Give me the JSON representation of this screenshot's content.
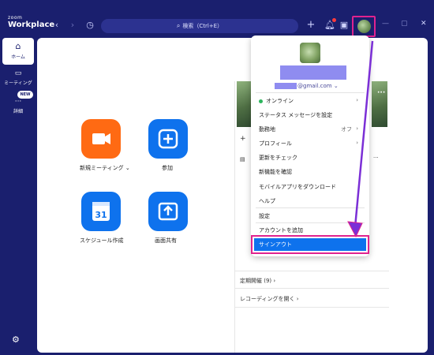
{
  "app": {
    "logo_small": "zoom",
    "logo_big": "Workplace"
  },
  "titlebar": {
    "search_text": "検索（Ctrl+E）",
    "icons": [
      "back-icon",
      "forward-icon",
      "history-icon",
      "plus-icon",
      "bell-icon",
      "whiteboard-icon"
    ]
  },
  "sidebar": {
    "home_label": "ホーム",
    "meeting_label": "ミーティング",
    "more_label": "詳細",
    "new_badge": "NEW"
  },
  "main": {
    "tiles": [
      {
        "label": "新規ミーティング",
        "icon": "video-camera-icon",
        "color": "#ff6a13"
      },
      {
        "label": "参加",
        "icon": "plus-icon",
        "color": "#0e72ed"
      },
      {
        "label": "スケジュール作成",
        "icon": "calendar-icon",
        "number": "31",
        "color": "#0e72ed"
      },
      {
        "label": "画面共有",
        "icon": "share-up-arrow-icon",
        "color": "#0e72ed"
      }
    ],
    "right_panel": {
      "recurring_label": "定期開催 (9)",
      "recordings_label": "レコーディングを開く"
    }
  },
  "menu": {
    "email_suffix": "@gmail.com",
    "items": [
      {
        "label": "オンライン",
        "status": "online",
        "chevron": true
      },
      {
        "label": "ステータス メッセージを設定"
      },
      {
        "label": "勤務地",
        "side_text": "オフ",
        "chevron": true
      },
      {
        "label": "プロフィール",
        "chevron": true
      },
      {
        "label": "更新をチェック"
      },
      {
        "label": "新機能を確認"
      },
      {
        "label": "モバイルアプリをダウンロード"
      },
      {
        "label": "ヘルプ"
      },
      {
        "label": "設定"
      },
      {
        "label": "アカウントを追加"
      }
    ],
    "signout_label": "サインアウト"
  },
  "colors": {
    "window_bg": "#1a1f6e",
    "accent_blue": "#0e72ed",
    "accent_orange": "#ff6a13",
    "highlight_magenta": "#e0238f",
    "annotation_arrow": "#7b2fd6"
  }
}
